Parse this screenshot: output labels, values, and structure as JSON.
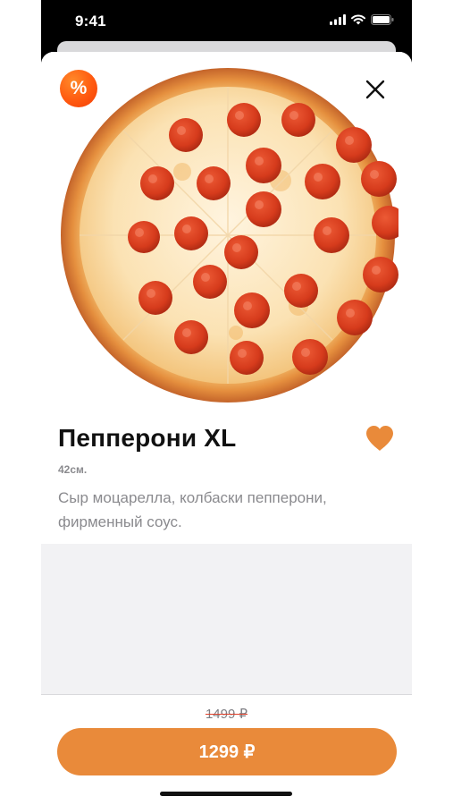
{
  "status_bar": {
    "time": "9:41"
  },
  "product": {
    "name": "Пепперони XL",
    "size": "42см.",
    "description": "Сыр моцарелла, колбаски пепперони, фирменный соус.",
    "badge": "%",
    "image_icon": "pepperoni-pizza"
  },
  "actions": {
    "close_icon": "close-icon",
    "favorite_icon": "heart-icon"
  },
  "pricing": {
    "old_price": "1499 ₽",
    "price": "1299 ₽"
  },
  "colors": {
    "accent": "#e98a3a",
    "badge_orange": "#ff5a10",
    "heart": "#e98a3a"
  }
}
